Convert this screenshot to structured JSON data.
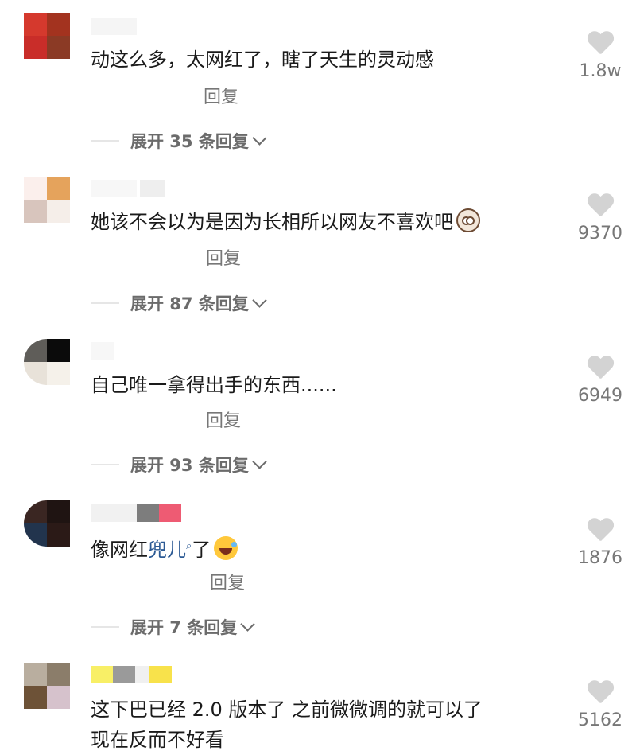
{
  "comments": [
    {
      "text": "动这么多，太网红了，瞎了天生的灵动感",
      "reply_label": "回复",
      "expand_label": "展开 35 条回复",
      "likes": "1.8w"
    },
    {
      "text": "她该不会以为是因为长相所以网友不喜欢吧",
      "reply_label": "回复",
      "expand_label": "展开 87 条回复",
      "likes": "9370"
    },
    {
      "text": "自己唯一拿得出手的东西......",
      "reply_label": "回复",
      "expand_label": "展开 93 条回复",
      "likes": "6949"
    },
    {
      "text_before_link": "像网红",
      "link_text": "兜儿",
      "text_after_link": "了",
      "reply_label": "回复",
      "expand_label": "展开 7 条回复",
      "likes": "1876"
    },
    {
      "text": "这下巴已经 2.0 版本了 之前微微调的就可以了\n现在反而不好看",
      "likes": "5162"
    }
  ],
  "colors": {
    "link": "#2c5a94",
    "secondary_text": "#777777",
    "heart": "#d3d3d3"
  },
  "icons": {
    "like": "heart-icon",
    "expand": "chevron-down-icon",
    "link_search": "search-icon"
  }
}
